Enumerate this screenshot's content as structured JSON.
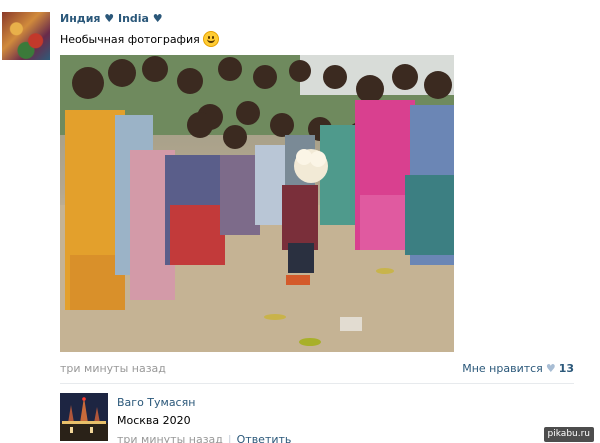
{
  "post": {
    "author_name": "Индия ♥ India ♥",
    "text": "Необычная фотография",
    "emoji_icon": "smile-emoji-icon",
    "photo_icon": "photo",
    "time": "три минуты назад",
    "like_label": "Мне нравится",
    "like_icon": "heart-icon",
    "like_count": "13"
  },
  "comment": {
    "author_name": "Ваго Тумасян",
    "text": "Москва 2020",
    "time": "три минуты назад",
    "reply_label": "Ответить"
  },
  "watermark": "pikabu.ru",
  "colors": {
    "link": "#2b587a",
    "muted": "#999999",
    "divider": "#e7eaed",
    "heart": "#a8bdd4"
  }
}
